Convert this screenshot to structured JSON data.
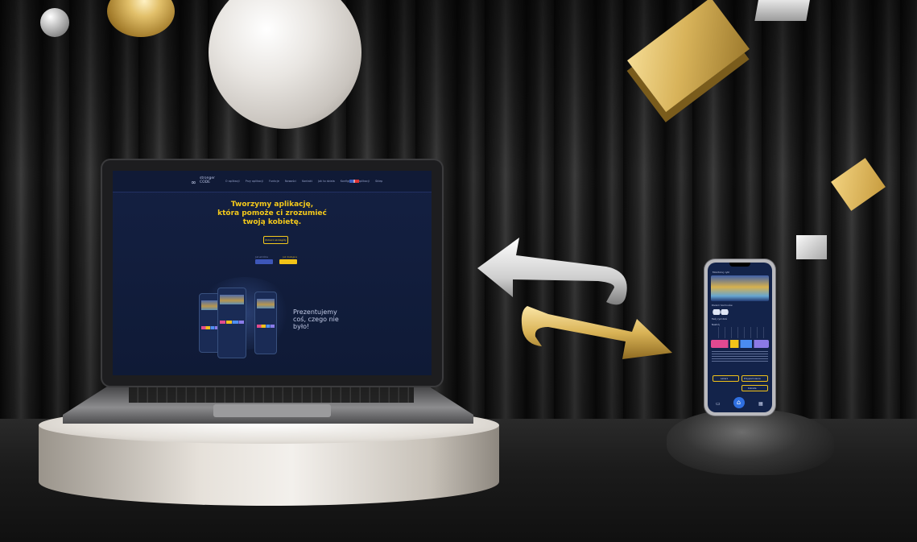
{
  "website": {
    "logo_text": "stronger",
    "brand": "CODE",
    "nav_items": [
      "O aplikacji",
      "Przy aplikacji",
      "Funkcje",
      "Nowości",
      "Kontakt",
      "Jak to działa",
      "Konfiguracja aplikacji",
      "Sklep"
    ],
    "hero_line1": "Tworzymy aplikację,",
    "hero_line2": "która pomoże ci zrozumieć",
    "hero_line3": "twoją kobietę.",
    "cta_button": "Zobacz szczegóły",
    "store_label_1": "Już wkrótce",
    "store_label_2": "Już dostępna",
    "tagline_line1": "Prezentujemy",
    "tagline_line2": "coś, czego nie",
    "tagline_line3": "było!"
  },
  "phone_app": {
    "header_title": "Monitoruj cykl",
    "section_1": "Poziom hormonów",
    "section_2": "Twój cykl dziś",
    "section_3": "Nastrój",
    "button_1": "Lekarz",
    "button_2": "Przypomnienie",
    "button_3": "Kobieta",
    "home_icon": "home-icon"
  },
  "colors": {
    "brand_yellow": "#f4c91b",
    "site_background": "#142042",
    "app_blue": "#2f6fe0"
  }
}
